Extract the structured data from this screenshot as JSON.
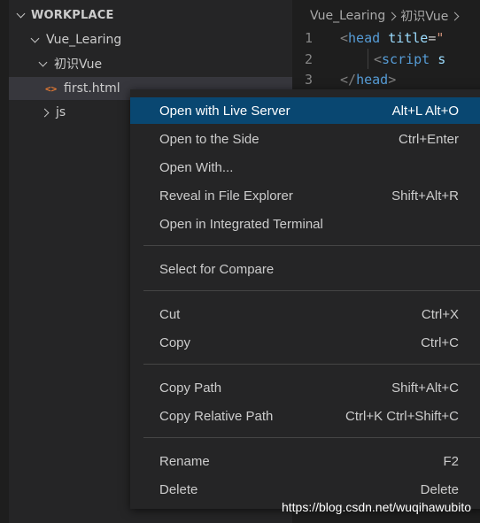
{
  "explorer": {
    "section_title": "WORKPLACE",
    "items": [
      {
        "label": "Vue_Learing"
      },
      {
        "label": "初识Vue"
      },
      {
        "label": "first.html",
        "icon": "<>"
      },
      {
        "label": "js"
      }
    ]
  },
  "editor": {
    "breadcrumb": [
      "Vue_Learing",
      "初识Vue"
    ],
    "lines": [
      {
        "num": "1",
        "tag_open": "<",
        "tag": "head",
        "attr": "title",
        "eq": "=",
        "str": "\""
      },
      {
        "num": "2",
        "tag_open": "<",
        "tag": "script",
        "attr": "s"
      },
      {
        "num": "3",
        "tag_open": "</",
        "tag": "head",
        "tag_close": ">"
      }
    ]
  },
  "context_menu": {
    "items": [
      {
        "label": "Open with Live Server",
        "shortcut": "Alt+L Alt+O"
      },
      {
        "label": "Open to the Side",
        "shortcut": "Ctrl+Enter"
      },
      {
        "label": "Open With...",
        "shortcut": ""
      },
      {
        "label": "Reveal in File Explorer",
        "shortcut": "Shift+Alt+R"
      },
      {
        "label": "Open in Integrated Terminal",
        "shortcut": ""
      },
      {
        "label": "Select for Compare",
        "shortcut": ""
      },
      {
        "label": "Cut",
        "shortcut": "Ctrl+X"
      },
      {
        "label": "Copy",
        "shortcut": "Ctrl+C"
      },
      {
        "label": "Copy Path",
        "shortcut": "Shift+Alt+C"
      },
      {
        "label": "Copy Relative Path",
        "shortcut": "Ctrl+K Ctrl+Shift+C"
      },
      {
        "label": "Rename",
        "shortcut": "F2"
      },
      {
        "label": "Delete",
        "shortcut": "Delete"
      }
    ]
  },
  "watermark": "https://blog.csdn.net/wuqihawubito",
  "colors": {
    "menu_highlight": "#094771",
    "tag": "#569cd6",
    "attr": "#9cdcfe",
    "html_icon": "#e37933"
  }
}
